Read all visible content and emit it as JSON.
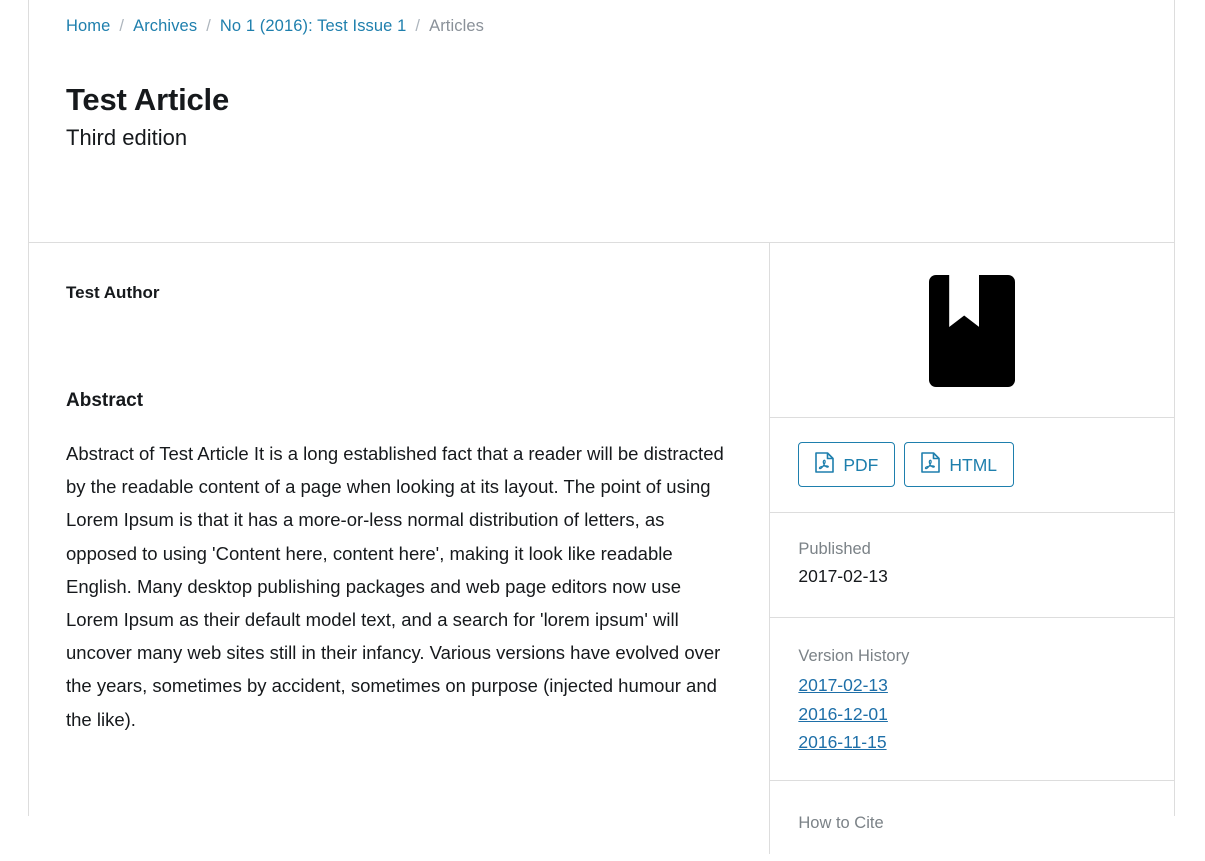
{
  "breadcrumb": {
    "separator": "/",
    "items": [
      {
        "label": "Home",
        "type": "link"
      },
      {
        "label": "Archives",
        "type": "link"
      },
      {
        "label": "No 1 (2016): Test Issue 1",
        "type": "link"
      },
      {
        "label": "Articles",
        "type": "current"
      }
    ]
  },
  "article": {
    "title": "Test Article",
    "subtitle": "Third edition",
    "authors": "Test Author",
    "abstract_heading": "Abstract",
    "abstract": "Abstract of Test Article It is a long established fact that a reader will be distracted by the readable content of a page when looking at its layout. The point of using Lorem Ipsum is that it has a more-or-less normal distribution of letters, as opposed to using 'Content here, content here', making it look like readable English. Many desktop publishing packages and web page editors now use Lorem Ipsum as their default model text, and a search for 'lorem ipsum' will uncover many web sites still in their infancy. Various versions have evolved over the years, sometimes by accident, sometimes on purpose (injected humour and the like)."
  },
  "sidebar": {
    "cover": {
      "icon": "book-cover-placeholder-icon"
    },
    "galleys": [
      {
        "label": "PDF",
        "icon": "file-pdf-icon"
      },
      {
        "label": "HTML",
        "icon": "file-pdf-icon"
      }
    ],
    "published": {
      "label": "Published",
      "value": "2017-02-13"
    },
    "version_history": {
      "label": "Version History",
      "versions": [
        {
          "date": "2017-02-13"
        },
        {
          "date": "2016-12-01"
        },
        {
          "date": "2016-11-15"
        }
      ]
    },
    "how_to_cite": {
      "label": "How to Cite"
    }
  },
  "colors": {
    "link": "#1e7fad",
    "link_visited": "#1e6fa8",
    "muted_text": "#7b8287",
    "body_text": "#16191c",
    "border": "#dddddd",
    "cover_background": "#000000"
  }
}
